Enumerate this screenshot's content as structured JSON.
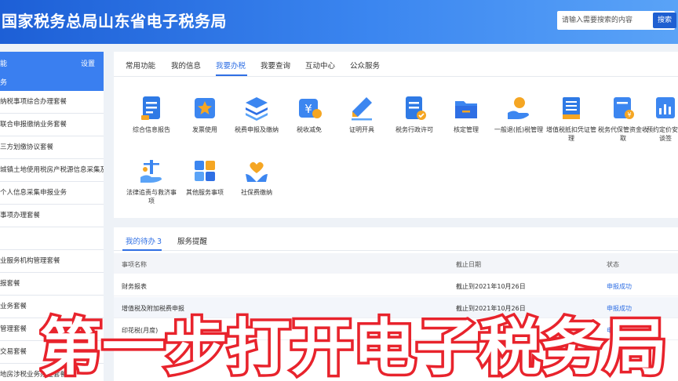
{
  "header": {
    "title": "国家税务总局山东省电子税务局",
    "search_placeholder": "请输入需要搜索的内容",
    "search_button": "搜索"
  },
  "sidebar": {
    "head_label": "能",
    "settings_label": "设置",
    "sub_label": "务",
    "items": [
      "纳税事项综合办理套餐",
      "联合申报缴纳业务套餐",
      "三方划缴协议套餐",
      "城镇土地使用税房产税源信息采集及申",
      "个人信息采集申报业务",
      "事项办理套餐",
      "",
      "业服务机构管理套餐",
      "报套餐",
      "业务套餐",
      "管理套餐",
      "交易套餐",
      "地房涉税业务办理套餐"
    ]
  },
  "main": {
    "tabs": [
      "常用功能",
      "我的信息",
      "我要办税",
      "我要查询",
      "互动中心",
      "公众服务"
    ],
    "active_tab": 2,
    "functions_row1": [
      {
        "label": "综合信息报告",
        "icon": "doc-list-icon"
      },
      {
        "label": "发票使用",
        "icon": "invoice-star-icon"
      },
      {
        "label": "税费申报及缴纳",
        "icon": "layers-icon"
      },
      {
        "label": "税收减免",
        "icon": "yen-tag-icon"
      },
      {
        "label": "证明开具",
        "icon": "pencil-icon"
      },
      {
        "label": "税务行政许可",
        "icon": "doc-check-icon"
      },
      {
        "label": "核定管理",
        "icon": "folder-icon"
      },
      {
        "label": "一般退(抵)税管理",
        "icon": "refund-hand-icon"
      },
      {
        "label": "增值税抵扣凭证管理",
        "icon": "ledger-icon"
      },
      {
        "label": "税务代保管资金收取",
        "icon": "safe-doc-icon"
      },
      {
        "label": "预约定价安排谈签",
        "icon": "chart-doc-icon"
      }
    ],
    "functions_row2": [
      {
        "label": "法律追责与救济事项",
        "icon": "hand-scale-icon"
      },
      {
        "label": "其他服务事项",
        "icon": "puzzle-icon"
      },
      {
        "label": "社保费缴纳",
        "icon": "hands-heart-icon"
      }
    ]
  },
  "pending": {
    "tabs": [
      "我的待办",
      "服务提醒"
    ],
    "todo_count": "3",
    "columns": [
      "事项名称",
      "截止日期",
      "状态"
    ],
    "rows": [
      {
        "name": "财务报表",
        "deadline": "截止到2021年10月26日",
        "status": "申报成功"
      },
      {
        "name": "增值税及附加税费申报",
        "deadline": "截止到2021年10月26日",
        "status": "申报成功"
      },
      {
        "name": "印花税(月度)",
        "deadline": "",
        "status": "申"
      }
    ]
  },
  "caption": {
    "text": "第一步打开电子税务局"
  },
  "colors": {
    "brand_blue": "#2f6fe4",
    "header_start": "#1d5fd6",
    "caption_fill": "#ffffff",
    "caption_stroke": "#e8232c"
  }
}
